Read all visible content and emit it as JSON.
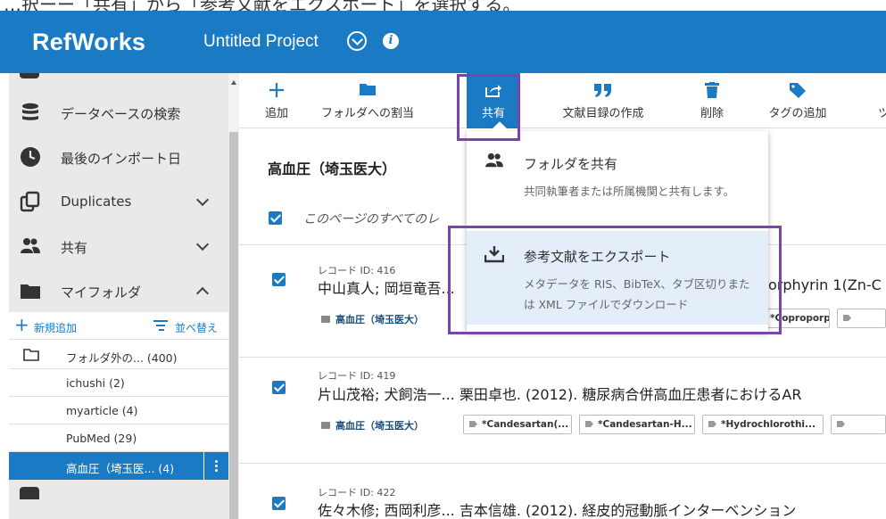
{
  "caption": "…択ーー「共有」から「参考文献をエクスポート」を選択する。",
  "header": {
    "app_name": "RefWorks",
    "project_title": "Untitled Project",
    "bg_color": "#1b7ac4"
  },
  "sidebar": {
    "nav_items": [
      {
        "label": "データベースの検索",
        "icon": "database-icon"
      },
      {
        "label": "最後のインポート日",
        "icon": "clock-icon"
      },
      {
        "label": "Duplicates",
        "icon": "duplicates-icon",
        "chevron": "down"
      },
      {
        "label": "共有",
        "icon": "people-icon",
        "chevron": "down"
      },
      {
        "label": "マイフォルダ",
        "icon": "folder-icon",
        "chevron": "up"
      }
    ],
    "folder_actions": {
      "add": "新規追加",
      "sort": "並べ替え"
    },
    "folders": [
      {
        "label": "フォルダ外の... (400)",
        "icon": "folder-outline-icon"
      },
      {
        "label": "ichushi (2)"
      },
      {
        "label": "myarticle (4)"
      },
      {
        "label": "PubMed (29)"
      },
      {
        "label": "高血圧（埼玉医... (4)",
        "selected": true
      }
    ]
  },
  "toolbar": {
    "items": [
      {
        "label": "追加",
        "icon": "plus-icon"
      },
      {
        "label": "フォルダへの割当",
        "icon": "folder-icon"
      },
      {
        "label": "共有",
        "icon": "share-icon",
        "active": true
      },
      {
        "label": "文献目録の作成",
        "icon": "quote-icon"
      },
      {
        "label": "削除",
        "icon": "trash-icon"
      },
      {
        "label": "タグの追加",
        "icon": "tag-icon"
      },
      {
        "label": "ツ",
        "icon": "tools-icon"
      }
    ]
  },
  "main": {
    "folder_title": "高血圧（埼玉医大）",
    "select_all": "このページのすべてのレ"
  },
  "records": [
    {
      "id": "レコード ID: 416",
      "title": "中山真人; 岡垣竜吾...",
      "title_tail": "orphyrin 1(Zn-C",
      "folder": "高血圧（埼玉医大）",
      "tags": [
        "*Coproporphyrin..."
      ]
    },
    {
      "id": "レコード ID: 419",
      "title": "片山茂裕; 犬飼浩一... 栗田卓也. (2012). 糖尿病合併高血圧患者におけるAR",
      "folder": "高血圧（埼玉医大）",
      "tags": [
        "*Candesartan(...",
        "*Candesartan-H...",
        "*Hydrochlorothi..."
      ]
    },
    {
      "id": "レコード ID: 422",
      "title": "佐々木修; 西岡利彦... 吉本信雄. (2012). 経皮的冠動脈インターベンション"
    }
  ],
  "dropdown": {
    "items": [
      {
        "title": "フォルダを共有",
        "desc": "共同執筆者または所属機関と共有します。",
        "icon": "people-icon"
      },
      {
        "title": "参考文献をエクスポート",
        "desc": "メタデータを RIS、BibTeX、タブ区切りまたは XML ファイルでダウンロード",
        "icon": "download-icon",
        "hover": true
      }
    ]
  },
  "colors": {
    "accent": "#1b7ac4",
    "highlight_box": "#7a45a8",
    "hover_bg": "#e3eef8"
  }
}
